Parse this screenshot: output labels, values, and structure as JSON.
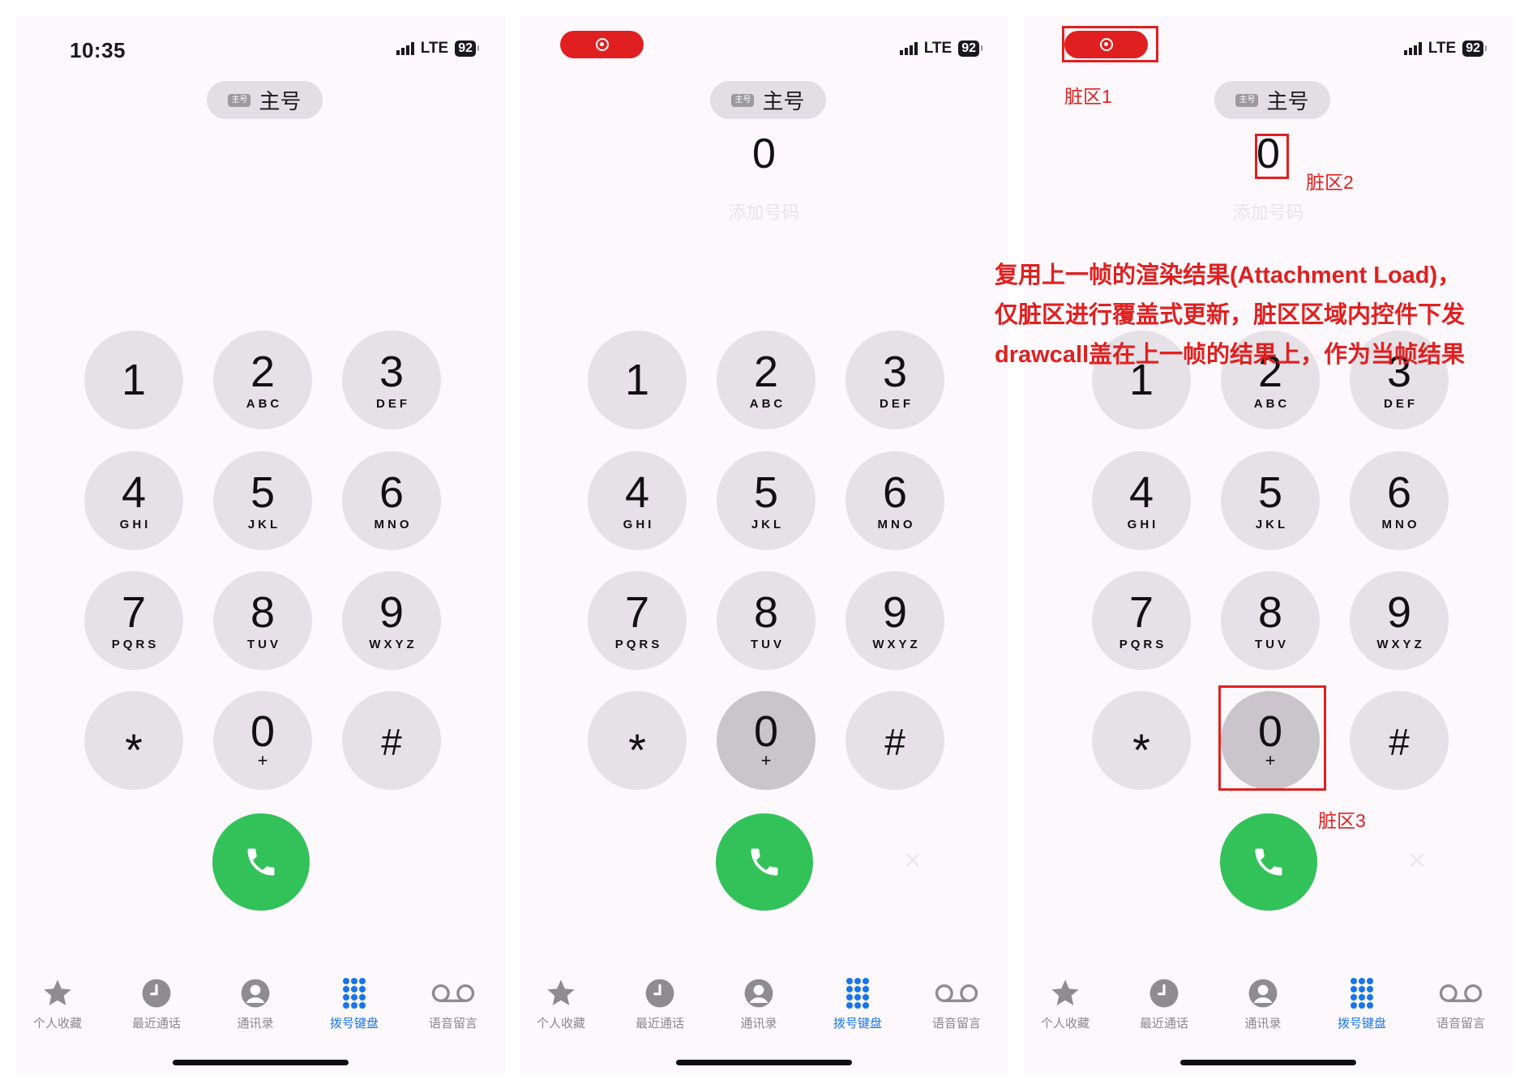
{
  "status_bar": {
    "time": "10:35",
    "network": "LTE",
    "battery": "92"
  },
  "line_selector": {
    "badge": "主号",
    "label": "主号"
  },
  "entered_number": "0",
  "add_number_hint": "添加号码",
  "keys": [
    {
      "digit": "1",
      "letters": ""
    },
    {
      "digit": "2",
      "letters": "ABC"
    },
    {
      "digit": "3",
      "letters": "DEF"
    },
    {
      "digit": "4",
      "letters": "GHI"
    },
    {
      "digit": "5",
      "letters": "JKL"
    },
    {
      "digit": "6",
      "letters": "MNO"
    },
    {
      "digit": "7",
      "letters": "PQRS"
    },
    {
      "digit": "8",
      "letters": "TUV"
    },
    {
      "digit": "9",
      "letters": "WXYZ"
    },
    {
      "digit": "*",
      "letters": ""
    },
    {
      "digit": "0",
      "letters": "+"
    },
    {
      "digit": "#",
      "letters": ""
    }
  ],
  "tabs": [
    {
      "label": "个人收藏",
      "icon": "star-icon"
    },
    {
      "label": "最近通话",
      "icon": "clock-icon"
    },
    {
      "label": "通讯录",
      "icon": "person-icon"
    },
    {
      "label": "拨号键盘",
      "icon": "keypad-icon",
      "active": true
    },
    {
      "label": "语音留言",
      "icon": "voicemail-icon"
    }
  ],
  "annotations": {
    "dirty1": "脏区1",
    "dirty2": "脏区2",
    "dirty3": "脏区3",
    "note_lines": [
      "复用上一帧的渲染结果(Attachment Load)，",
      "仅脏区进行覆盖式更新，脏区区域内控件下发",
      "drawcall盖在上一帧的结果上，作为当帧结果"
    ]
  },
  "colors": {
    "call_green": "#33c15a",
    "active_tab": "#1a74e8",
    "annotation_red": "#e02020",
    "key_bg": "#e5e1e6",
    "key_pressed": "#c9c5ca"
  }
}
